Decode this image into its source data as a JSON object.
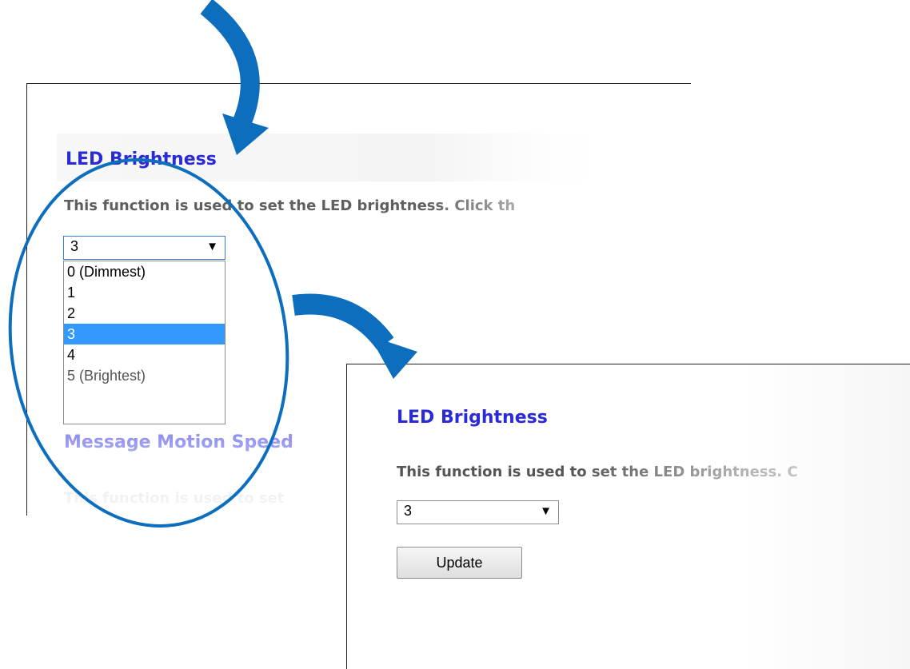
{
  "top_panel": {
    "section_title": "LED Brightness",
    "description": "This function is used to set the LED brightness. Click th",
    "select": {
      "value": "3",
      "arrow": "▼",
      "options": [
        "0 (Dimmest)",
        "1",
        "2",
        "3",
        "4",
        "5 (Brightest)"
      ],
      "highlighted_index": 3
    },
    "next_section_title": "Message Motion Speed",
    "next_description": "This function is used to set"
  },
  "bottom_panel": {
    "section_title": "LED Brightness",
    "description": "This function is used to set the LED brightness. C",
    "select": {
      "value": "3",
      "arrow": "▼"
    },
    "update_button": "Update"
  },
  "colors": {
    "annotation_blue": "#0d6ebd",
    "title_blue": "#2b2bd6",
    "highlight_blue": "#3399ff"
  },
  "icons": [
    "curved-arrow-icon",
    "dropdown-arrow-icon",
    "highlight-ellipse"
  ]
}
